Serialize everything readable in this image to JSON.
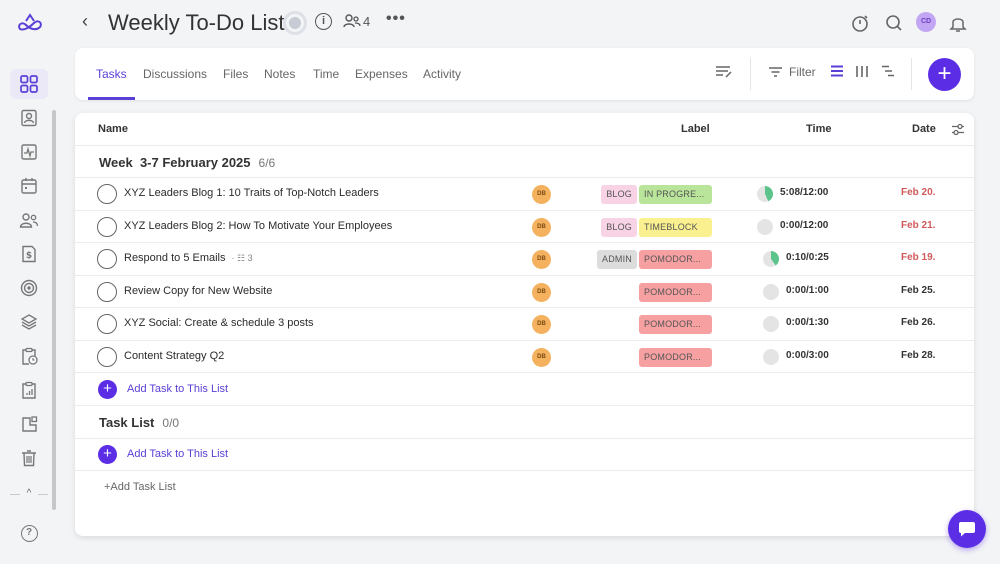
{
  "header": {
    "back_icon": "chevron-left-icon",
    "title": "Weekly To-Do List",
    "members_count": "4",
    "more": "•••",
    "avatar_initials": "CD"
  },
  "sidebar": {
    "items": [
      {
        "icon": "dashboard-grid-icon",
        "active": true
      },
      {
        "icon": "contact-icon"
      },
      {
        "icon": "activity-icon"
      },
      {
        "icon": "calendar-icon"
      },
      {
        "icon": "people-icon"
      },
      {
        "icon": "invoice-dollar-icon"
      },
      {
        "icon": "target-icon"
      },
      {
        "icon": "layers-icon"
      },
      {
        "icon": "clipboard-clock-icon"
      },
      {
        "icon": "clipboard-chart-icon"
      },
      {
        "icon": "boards-icon"
      },
      {
        "icon": "trash-icon"
      }
    ],
    "collapse": "^",
    "help": "?"
  },
  "tabs": {
    "items": [
      "Tasks",
      "Discussions",
      "Files",
      "Notes",
      "Time",
      "Expenses",
      "Activity"
    ],
    "active": "Tasks",
    "filter_label": "Filter",
    "add": "+"
  },
  "table": {
    "columns": {
      "name": "Name",
      "label": "Label",
      "time": "Time",
      "date": "Date"
    },
    "groups": [
      {
        "title": "Week  3-7 February 2025",
        "count": "6/6",
        "tasks": [
          {
            "name": "XYZ Leaders Blog 1: 10 Traits of Top-Notch Leaders",
            "assignee": "DB",
            "labels": [
              "BLOG",
              "IN PROGRE..."
            ],
            "time": "5:08/12:00",
            "progress": 0.43,
            "date": "Feb 20.",
            "overdue": true
          },
          {
            "name": "XYZ Leaders Blog 2: How To Motivate Your Employees",
            "assignee": "DB",
            "labels": [
              "BLOG",
              "TIMEBLOCK"
            ],
            "time": "0:00/12:00",
            "progress": 0,
            "date": "Feb 21.",
            "overdue": true
          },
          {
            "name": "Respond to 5 Emails",
            "subtasks": "3",
            "assignee": "DB",
            "labels": [
              "ADMIN",
              "POMODOR..."
            ],
            "time": "0:10/0:25",
            "progress": 0.4,
            "date": "Feb 19.",
            "overdue": true
          },
          {
            "name": "Review Copy for New Website",
            "assignee": "DB",
            "labels": [
              "POMODOR..."
            ],
            "time": "0:00/1:00",
            "progress": 0,
            "date": "Feb 25.",
            "overdue": false
          },
          {
            "name": "XYZ Social: Create & schedule 3 posts",
            "assignee": "DB",
            "labels": [
              "POMODOR..."
            ],
            "time": "0:00/1:30",
            "progress": 0,
            "date": "Feb 26.",
            "overdue": false
          },
          {
            "name": "Content Strategy Q2",
            "assignee": "DB",
            "labels": [
              "POMODOR..."
            ],
            "time": "0:00/3:00",
            "progress": 0,
            "date": "Feb 28.",
            "overdue": false
          }
        ],
        "add_task": "Add Task to This List"
      },
      {
        "title": "Task List",
        "count": "0/0",
        "tasks": [],
        "add_task": "Add Task to This List"
      }
    ],
    "add_list": "+Add Task List"
  },
  "colors": {
    "accent": "#5b2ee6",
    "overdue": "#d05a5a",
    "label_blog": "#f8d3e6",
    "label_in_progress": "#b9e59a",
    "label_timeblock": "#fbf08f",
    "label_admin": "#dcdcdc",
    "label_pomodoro": "#f6a0a2",
    "progress": "#5cc48a"
  }
}
